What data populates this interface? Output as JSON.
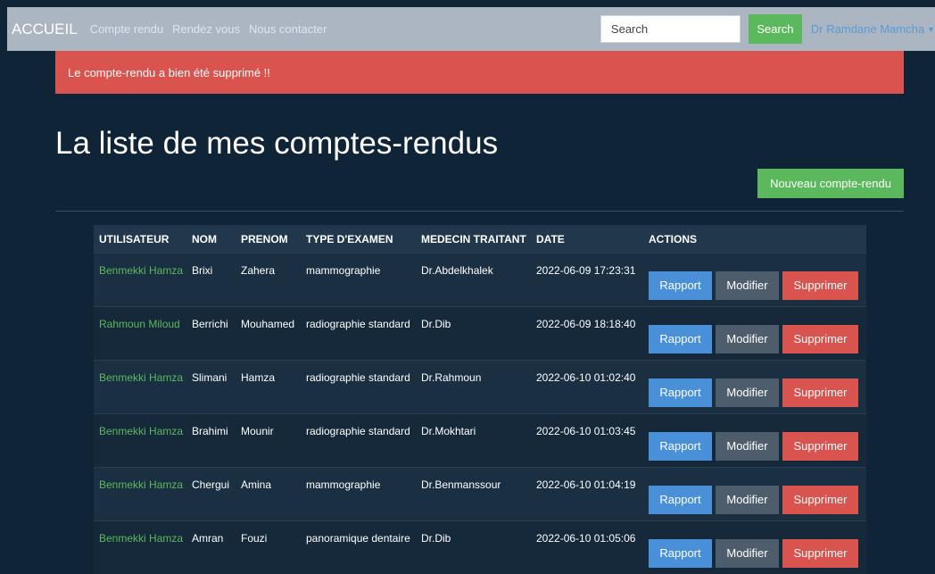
{
  "navbar": {
    "brand": "ACCUEIL",
    "links": [
      "Compte rendu",
      "Rendez vous",
      "Nous contacter"
    ],
    "search_placeholder": "Search",
    "search_button": "Search",
    "user": "Dr Ramdane Mamcha"
  },
  "alert": {
    "text": "Le compte-rendu a bien été supprimé !!"
  },
  "page": {
    "title": "La liste de mes comptes-rendus",
    "new_button": "Nouveau compte-rendu"
  },
  "table": {
    "headers": [
      "UTILISATEUR",
      "NOM",
      "PRENOM",
      "TYPE D'EXAMEN",
      "MEDECIN TRAITANT",
      "DATE",
      "ACTIONS"
    ],
    "actions": {
      "rapport": "Rapport",
      "modifier": "Modifier",
      "supprimer": "Supprimer"
    },
    "rows": [
      {
        "utilisateur": "Benmekki Hamza",
        "nom": "Brixi",
        "prenom": "Zahera",
        "type": "mammographie",
        "medecin": "Dr.Abdelkhalek",
        "date": "2022-06-09 17:23:31"
      },
      {
        "utilisateur": "Rahmoun Miloud",
        "nom": "Berrichi",
        "prenom": "Mouhamed",
        "type": "radiographie standard",
        "medecin": "Dr.Dib",
        "date": "2022-06-09 18:18:40"
      },
      {
        "utilisateur": "Benmekki Hamza",
        "nom": "Slimani",
        "prenom": "Hamza",
        "type": "radiographie standard",
        "medecin": "Dr.Rahmoun",
        "date": "2022-06-10 01:02:40"
      },
      {
        "utilisateur": "Benmekki Hamza",
        "nom": "Brahimi",
        "prenom": "Mounir",
        "type": "radiographie standard",
        "medecin": "Dr.Mokhtari",
        "date": "2022-06-10 01:03:45"
      },
      {
        "utilisateur": "Benmekki Hamza",
        "nom": "Chergui",
        "prenom": "Amina",
        "type": "mammographie",
        "medecin": "Dr.Benmanssour",
        "date": "2022-06-10 01:04:19"
      },
      {
        "utilisateur": "Benmekki Hamza",
        "nom": "Amran",
        "prenom": "Fouzi",
        "type": "panoramique dentaire",
        "medecin": "Dr.Dib",
        "date": "2022-06-10 01:05:06"
      }
    ]
  },
  "colors": {
    "background": "#0f2537",
    "navbar": "#abb6c2",
    "success": "#5cb85c",
    "danger": "#d9534f",
    "primary": "#4a90d9",
    "secondary": "#4e5d6c"
  },
  "icons": {
    "user_menu_caret": "caret-down-icon"
  }
}
